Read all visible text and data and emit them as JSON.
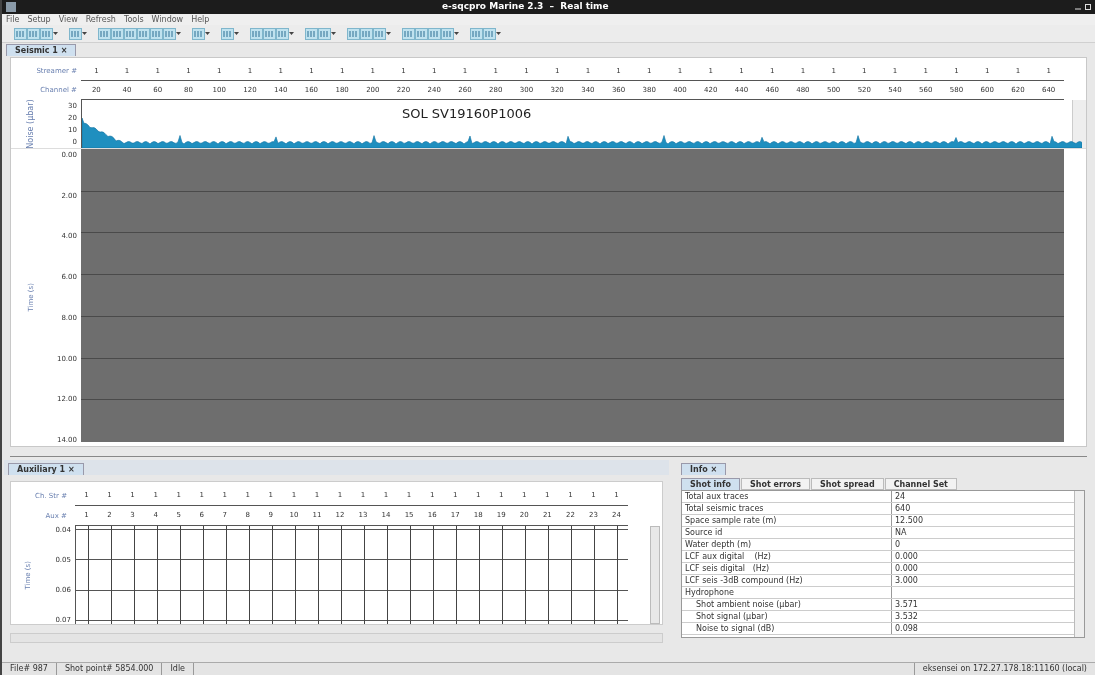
{
  "window": {
    "title": "e-sqcpro Marine 2.3  –  Real time"
  },
  "menu": [
    "File",
    "Setup",
    "View",
    "Refresh",
    "Tools",
    "Window",
    "Help"
  ],
  "top_tabs": [
    {
      "label": "Seismic 1 ×",
      "selected": true
    }
  ],
  "seismic": {
    "streamer_label": "Streamer #",
    "channel_label": "Channel #",
    "streamer_ticks": [
      "1",
      "1",
      "1",
      "1",
      "1",
      "1",
      "1",
      "1",
      "1",
      "1",
      "1",
      "1",
      "1",
      "1",
      "1",
      "1",
      "1",
      "1",
      "1",
      "1",
      "1",
      "1",
      "1",
      "1",
      "1",
      "1",
      "1",
      "1",
      "1",
      "1",
      "1",
      "1"
    ],
    "channel_ticks": [
      "20",
      "40",
      "60",
      "80",
      "100",
      "120",
      "140",
      "160",
      "180",
      "200",
      "220",
      "240",
      "260",
      "280",
      "300",
      "320",
      "340",
      "360",
      "380",
      "400",
      "420",
      "440",
      "460",
      "480",
      "500",
      "520",
      "540",
      "560",
      "580",
      "600",
      "620",
      "640"
    ],
    "noise_ylabel": "Noise (µbar)",
    "noise_ticks": [
      "30",
      "20",
      "10",
      "0"
    ],
    "noise_title": "SOL SV19160P1006",
    "time_ylabel": "Time (s)",
    "time_ticks": [
      "0.00",
      "2.00",
      "4.00",
      "6.00",
      "8.00",
      "10.00",
      "12.00",
      "14.00"
    ]
  },
  "aux_tabs": [
    {
      "label": "Auxiliary 1 ×",
      "selected": true
    }
  ],
  "aux": {
    "str_label": "Ch. Str #",
    "aux_label": "Aux #",
    "str_ticks": [
      "1",
      "1",
      "1",
      "1",
      "1",
      "1",
      "1",
      "1",
      "1",
      "1",
      "1",
      "1",
      "1",
      "1",
      "1",
      "1",
      "1",
      "1",
      "1",
      "1",
      "1",
      "1",
      "1",
      "1"
    ],
    "aux_ticks": [
      "1",
      "2",
      "3",
      "4",
      "5",
      "6",
      "7",
      "8",
      "9",
      "10",
      "11",
      "12",
      "13",
      "14",
      "15",
      "16",
      "17",
      "18",
      "19",
      "20",
      "21",
      "22",
      "23",
      "24"
    ],
    "time_ylabel": "Time (s)",
    "time_ticks": [
      "0.04",
      "0.05",
      "0.06",
      "0.07"
    ]
  },
  "info_tabs": [
    {
      "label": "Info ×",
      "selected": true
    }
  ],
  "info_subtabs": [
    {
      "label": "Shot info",
      "selected": true
    },
    {
      "label": "Shot errors",
      "selected": false
    },
    {
      "label": "Shot spread",
      "selected": false
    },
    {
      "label": "Channel Set",
      "selected": false
    }
  ],
  "info_rows": [
    {
      "name": "Total aux traces",
      "value": "24"
    },
    {
      "name": "Total seismic traces",
      "value": "640"
    },
    {
      "name": "Space sample rate (m)",
      "value": "12.500"
    },
    {
      "name": "Source id",
      "value": "NA"
    },
    {
      "name": "Water depth (m)",
      "value": "0"
    },
    {
      "name": "LCF aux digital    (Hz)",
      "value": "0.000"
    },
    {
      "name": "LCF seis digital   (Hz)",
      "value": "0.000"
    },
    {
      "name": "LCF seis -3dB compound (Hz)",
      "value": "3.000"
    },
    {
      "name": "Hydrophone",
      "children": [
        {
          "name": "Shot ambient noise (µbar)",
          "value": "3.571"
        },
        {
          "name": "Shot signal (µbar)",
          "value": "3.532"
        },
        {
          "name": "Noise to signal (dB)",
          "value": "0.098"
        }
      ]
    }
  ],
  "status_bar": {
    "left": [
      "File# 987",
      "Shot point# 5854.000",
      "Idle"
    ],
    "right": "eksensei on 172.27.178.18:11160 (local)"
  }
}
